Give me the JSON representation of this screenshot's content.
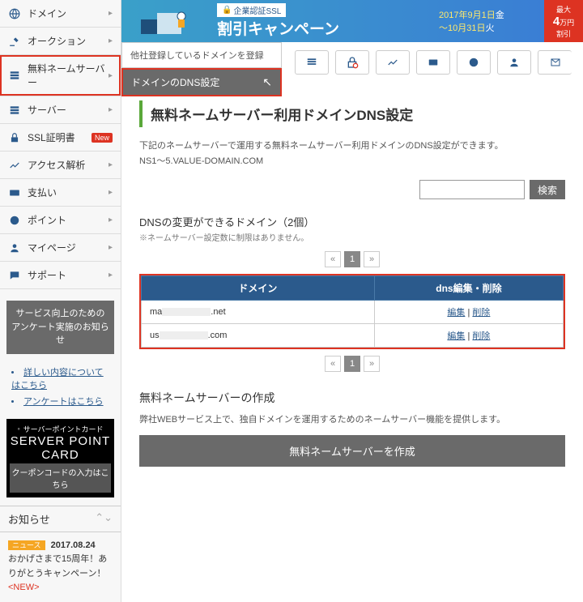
{
  "sidebar": {
    "items": [
      {
        "label": "ドメイン",
        "icon": "globe"
      },
      {
        "label": "オークション",
        "icon": "gavel"
      },
      {
        "label": "無料ネームサーバー",
        "icon": "server"
      },
      {
        "label": "サーバー",
        "icon": "server"
      },
      {
        "label": "SSL証明書",
        "icon": "lock",
        "badge": "New"
      },
      {
        "label": "アクセス解析",
        "icon": "chart"
      },
      {
        "label": "支払い",
        "icon": "card"
      },
      {
        "label": "ポイント",
        "icon": "coin"
      },
      {
        "label": "マイページ",
        "icon": "user"
      },
      {
        "label": "サポート",
        "icon": "chat"
      }
    ],
    "survey": {
      "line1": "サービス向上のための",
      "line2": "アンケート実施のお知らせ",
      "links": [
        "詳しい内容についてはこちら",
        "アンケートはこちら"
      ]
    },
    "spc": {
      "tag": "サーバーポイントカード",
      "title": "SERVER POINT CARD",
      "sub": "クーポンコードの入力はこちら"
    },
    "oshirase_heading": "お知らせ",
    "news": {
      "tag": "ニュース",
      "date": "2017.08.24",
      "body": "おかげさまで15周年！ありがとうキャンペーン！",
      "new": "<NEW>"
    }
  },
  "flyout": {
    "row1": "他社登録しているドメインを登録",
    "row2": "ドメインのDNS設定"
  },
  "banner": {
    "tag": "企業認証SSL",
    "title": "割引キャンペーン",
    "date1": "2017年9月1日",
    "dow1": "金",
    "date2": "～10月31日",
    "dow2": "火",
    "badge_top": "最大",
    "badge_big": "4",
    "badge_unit": "万円",
    "badge_bot": "割引"
  },
  "main": {
    "heading": "無料ネームサーバー利用ドメインDNS設定",
    "desc1": "下記のネームサーバーで運用する無料ネームサーバー利用ドメインのDNS設定ができます。",
    "desc2": "NS1～5.VALUE-DOMAIN.COM",
    "search_btn": "検索",
    "sub_heading": "DNSの変更ができるドメイン（2個）",
    "note": "※ネームサーバー設定数に制限はありません。",
    "table": {
      "headers": [
        "ドメイン",
        "dns編集・削除"
      ],
      "rows": [
        {
          "prefix": "ma",
          "suffix": ".net",
          "edit": "編集",
          "del": "削除"
        },
        {
          "prefix": "us",
          "suffix": ".com",
          "edit": "編集",
          "del": "削除"
        }
      ]
    },
    "create_heading": "無料ネームサーバーの作成",
    "create_desc": "弊社WEBサービス上で、独自ドメインを運用するためのネームサーバー機能を提供します。",
    "create_btn": "無料ネームサーバーを作成"
  },
  "pager": {
    "prev": "«",
    "cur": "1",
    "next": "»"
  }
}
